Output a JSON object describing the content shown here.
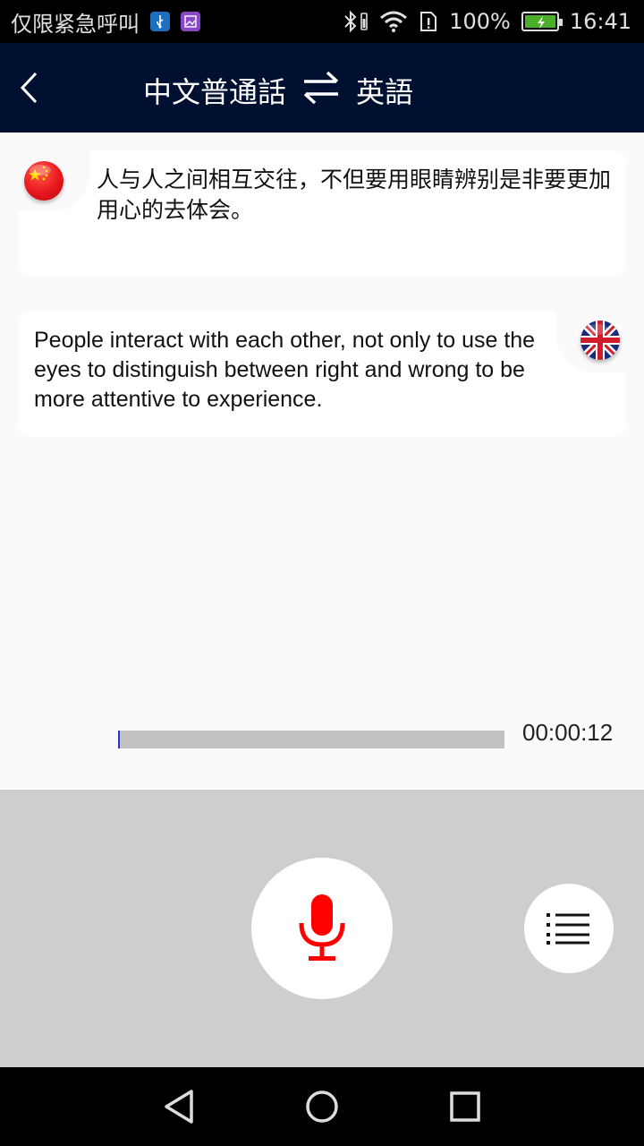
{
  "status_bar": {
    "carrier_text": "仅限紧急呼叫",
    "battery_percent": "100%",
    "battery_level": 1.0,
    "time": "16:41",
    "icons": [
      "usb-icon",
      "image-icon",
      "bluetooth-icon",
      "wifi-icon",
      "sim-alert-icon",
      "battery-charging-icon"
    ]
  },
  "app_bar": {
    "source_language": "中文普通話",
    "target_language": "英語",
    "back_icon": "chevron-left-icon",
    "swap_icon": "swap-arrows-icon"
  },
  "conversation": [
    {
      "speaker_flag": "china-flag-icon",
      "text": "人与人之间相互交往，不但要用眼睛辨别是非要更加用心的去体会。"
    },
    {
      "speaker_flag": "uk-flag-icon",
      "text": "People interact with each other, not only to use the eyes to distinguish between right and wrong to be more attentive to experience."
    }
  ],
  "playback": {
    "progress_fraction": 0.005,
    "elapsed": "00:00:12"
  },
  "controls": {
    "mic_icon": "microphone-icon",
    "list_icon": "list-menu-icon"
  },
  "nav_bar": {
    "icons": [
      "back-triangle-icon",
      "home-circle-icon",
      "recents-square-icon"
    ]
  },
  "colors": {
    "app_bar_bg": "#001030",
    "mic_red": "#ff0000",
    "progress_track": "#c2c2c2",
    "control_panel_bg": "#cecece"
  }
}
